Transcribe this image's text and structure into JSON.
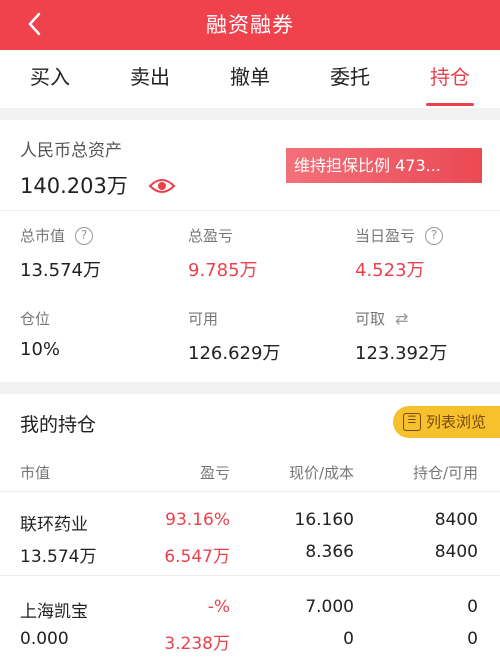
{
  "header": {
    "title": "融资融券"
  },
  "tabs": [
    {
      "label": "买入"
    },
    {
      "label": "卖出"
    },
    {
      "label": "撤单"
    },
    {
      "label": "委托"
    },
    {
      "label": "持仓"
    }
  ],
  "asset": {
    "label": "人民币总资产",
    "amount": "140.203万",
    "ratio_text": "维持担保比例 473..."
  },
  "stats": {
    "market_value": {
      "label": "总市值",
      "value": "13.574万"
    },
    "total_pl": {
      "label": "总盈亏",
      "value": "9.785万"
    },
    "today_pl": {
      "label": "当日盈亏",
      "value": "4.523万"
    },
    "position": {
      "label": "仓位",
      "value": "10%"
    },
    "available": {
      "label": "可用",
      "value": "126.629万"
    },
    "withdrawable": {
      "label": "可取",
      "value": "123.392万"
    }
  },
  "holdings": {
    "title": "我的持仓",
    "list_button": "列表浏览",
    "columns": [
      "市值",
      "盈亏",
      "现价/成本",
      "持仓/可用"
    ],
    "rows": [
      {
        "name": "联环药业",
        "market_value": "13.574万",
        "pl_pct": "93.16%",
        "pl_amount": "6.547万",
        "price": "16.160",
        "cost": "8.366",
        "holding": "8400",
        "available": "8400"
      },
      {
        "name": "上海凯宝",
        "market_value": "0.000",
        "pl_pct": "-%",
        "pl_amount": "3.238万",
        "price": "7.000",
        "cost": "0",
        "holding": "0",
        "available": "0"
      }
    ]
  },
  "colors": {
    "brand_red": "#f0424d",
    "accent_yellow": "#f6c12d"
  },
  "icons": {
    "back": "chevron-left-icon",
    "eye": "eye-icon",
    "help": "question-circle-icon",
    "swap": "swap-arrows-icon",
    "list": "list-view-icon"
  }
}
